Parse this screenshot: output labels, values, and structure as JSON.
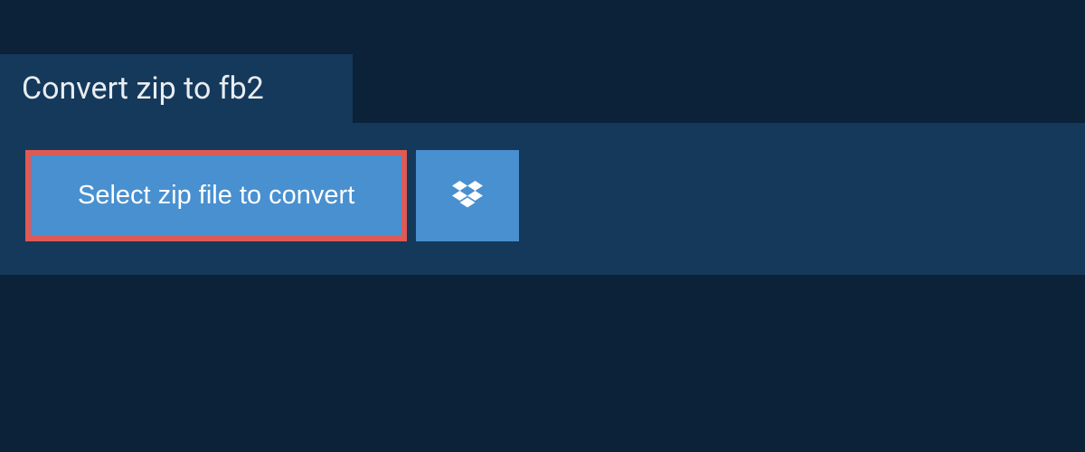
{
  "tab": {
    "title": "Convert zip to fb2"
  },
  "actions": {
    "select_label": "Select zip file to convert"
  },
  "colors": {
    "background": "#0c2239",
    "panel": "#15395b",
    "button": "#4990d0",
    "highlight_border": "#df5a56",
    "text_light": "#e8edf2",
    "button_text": "#ffffff"
  }
}
